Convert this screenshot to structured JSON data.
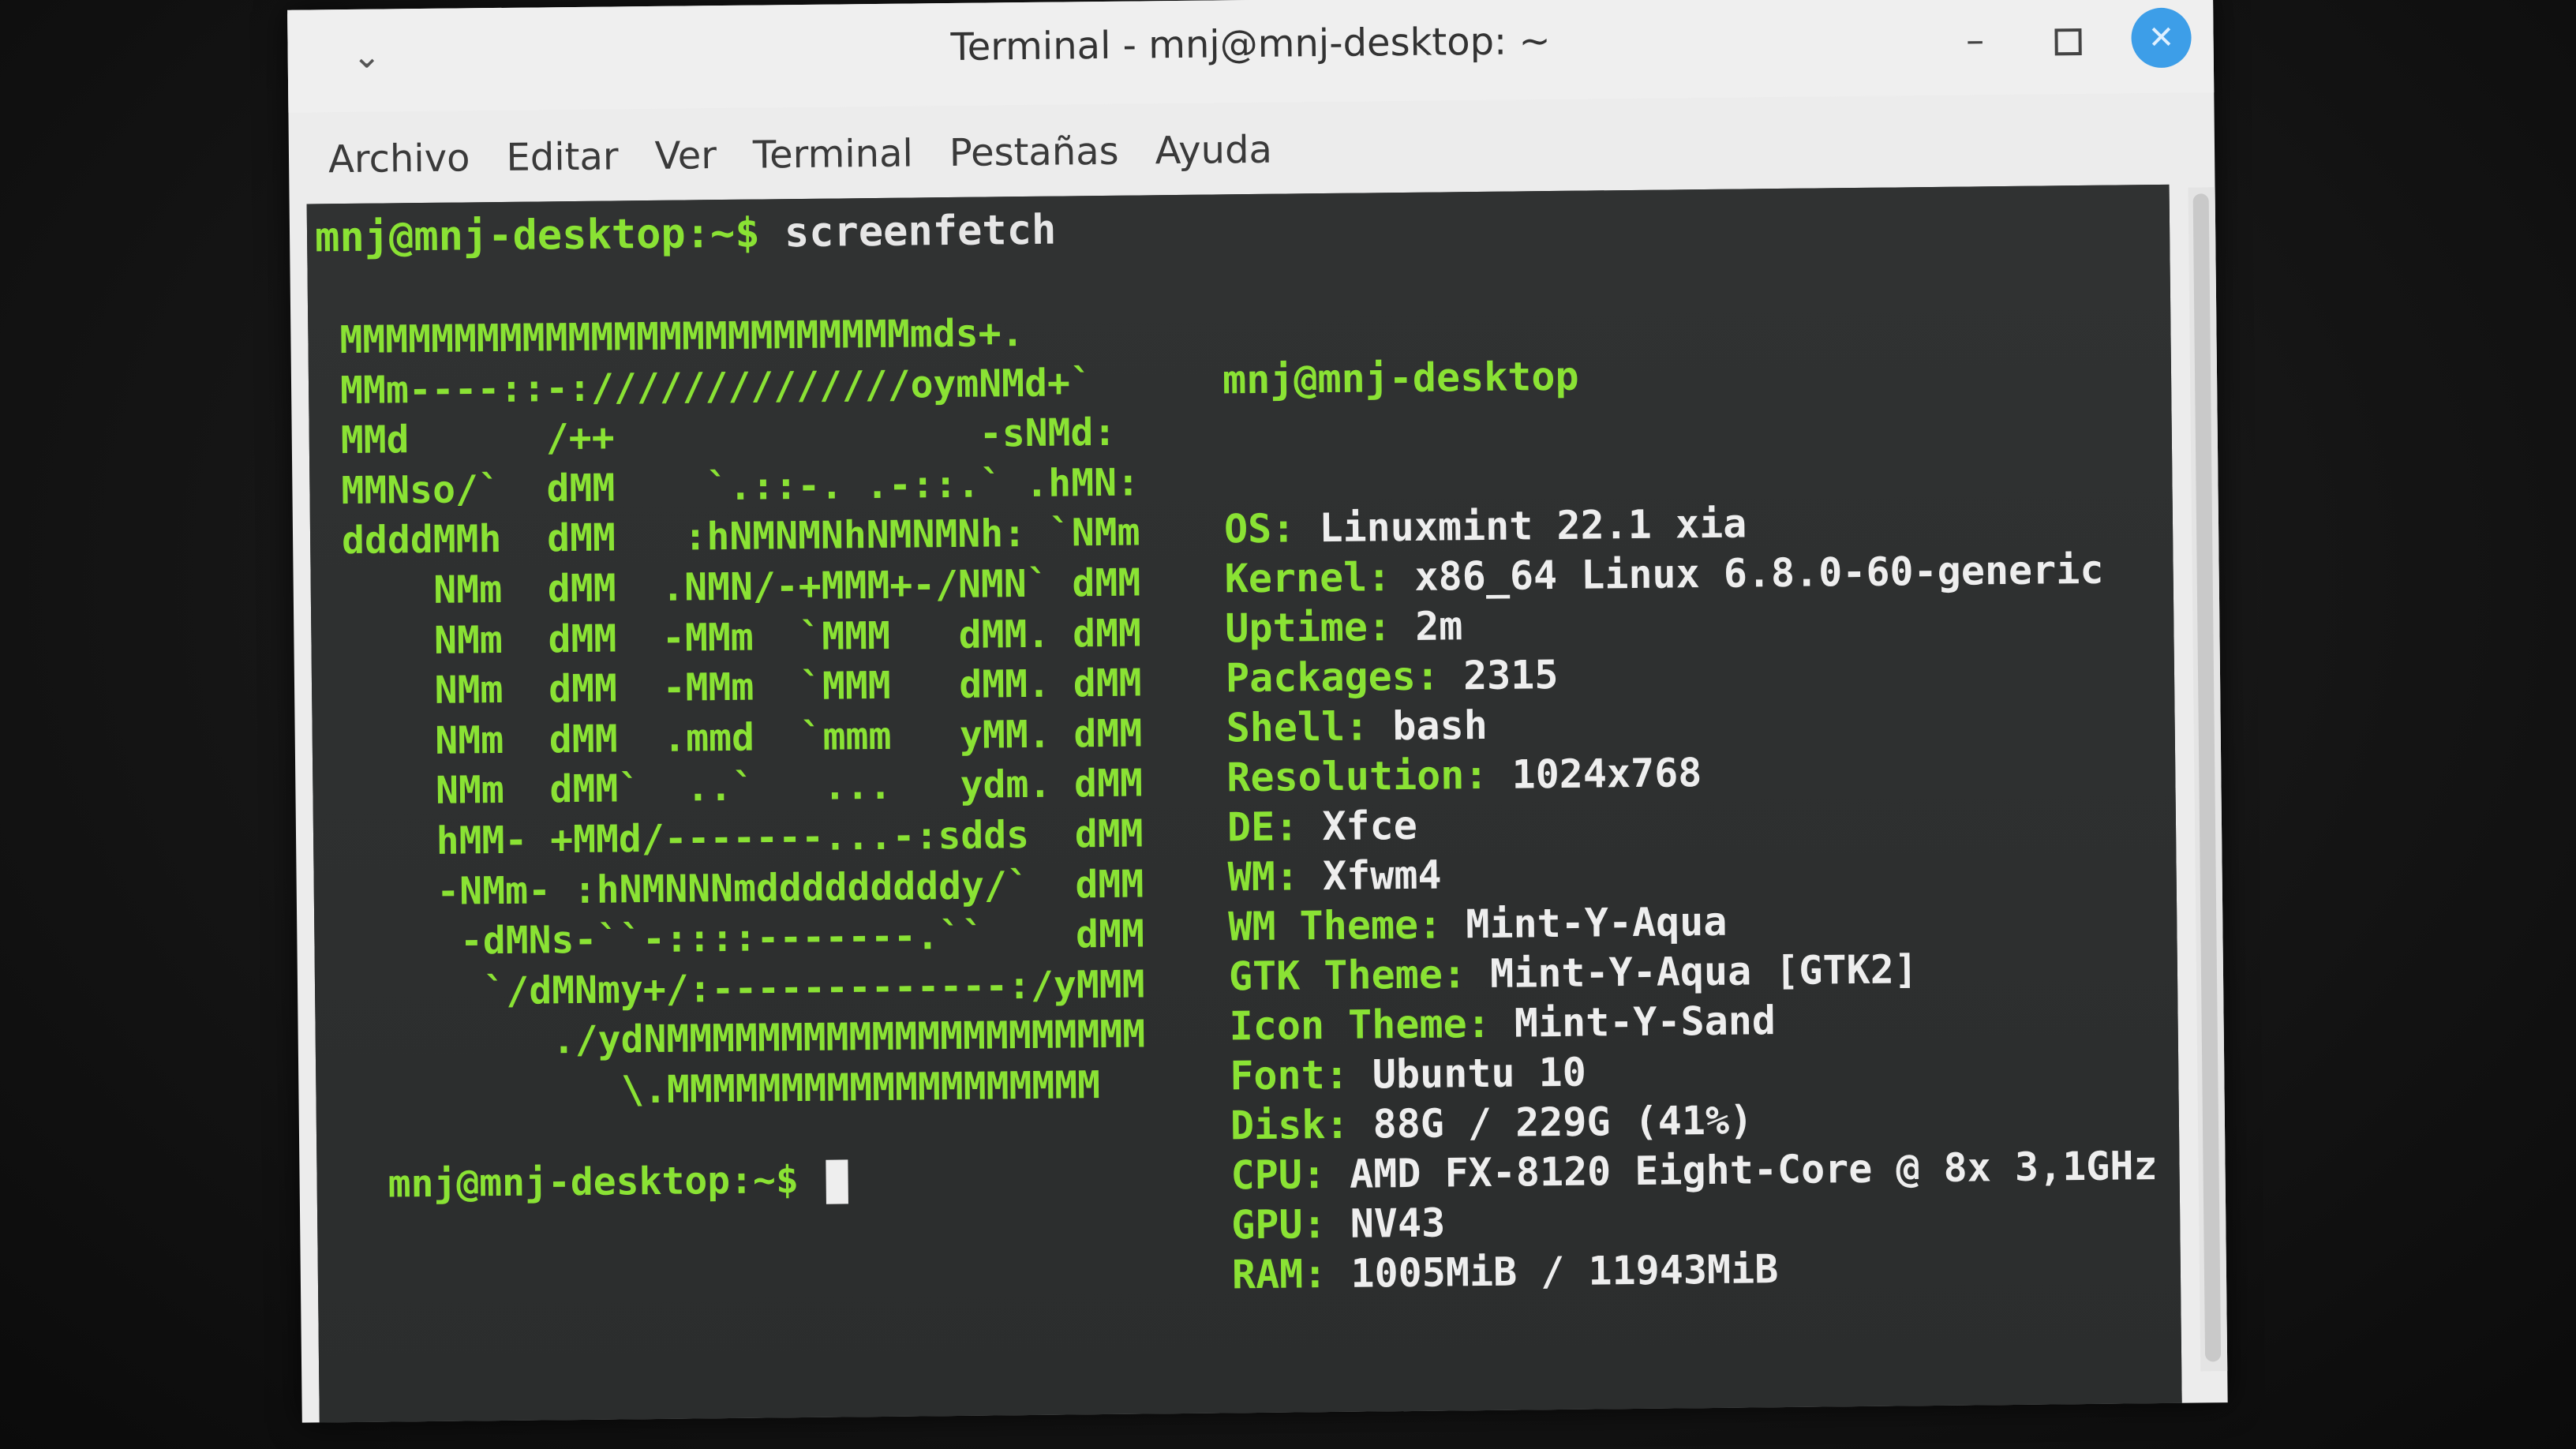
{
  "window": {
    "title": "Terminal - mnj@mnj-desktop: ~"
  },
  "menu": [
    "Archivo",
    "Editar",
    "Ver",
    "Terminal",
    "Pestañas",
    "Ayuda"
  ],
  "terminal": {
    "prompt": "mnj@mnj-desktop:~$",
    "command": " screenfetch",
    "hostname": "mnj@mnj-desktop",
    "art": [
      "MMMMMMMMMMMMMMMMMMMMMMMMMmds+.",
      "MMm----::-://////////////oymNMd+`",
      "MMd      /++                -sNMd:",
      "MMNso/`  dMM    `.::-. .-::.` .hMN:",
      "ddddMMh  dMM   :hNMNMNhNMNMNh: `NMm",
      "    NMm  dMM  .NMN/-+MMM+-/NMN` dMM",
      "    NMm  dMM  -MMm  `MMM   dMM. dMM",
      "    NMm  dMM  -MMm  `MMM   dMM. dMM",
      "    NMm  dMM  .mmd  `mmm   yMM. dMM",
      "    NMm  dMM`  ..`   ...   ydm. dMM",
      "    hMM- +MMd/-------...-:sdds  dMM",
      "    -NMm- :hNMNNNmdddddddddy/`  dMM",
      "     -dMNs-``-::::-------.``    dMM",
      "      `/dMNmy+/:-------------:/yMMM",
      "         ./ydNMMMMMMMMMMMMMMMMMMMMM",
      "            \\.MMMMMMMMMMMMMMMMMMM"
    ],
    "info": [
      {
        "label": "OS:",
        "value": " Linuxmint 22.1 xia"
      },
      {
        "label": "Kernel:",
        "value": " x86_64 Linux 6.8.0-60-generic"
      },
      {
        "label": "Uptime:",
        "value": " 2m"
      },
      {
        "label": "Packages:",
        "value": " 2315"
      },
      {
        "label": "Shell:",
        "value": " bash"
      },
      {
        "label": "Resolution:",
        "value": " 1024x768"
      },
      {
        "label": "DE:",
        "value": " Xfce"
      },
      {
        "label": "WM:",
        "value": " Xfwm4"
      },
      {
        "label": "WM Theme:",
        "value": " Mint-Y-Aqua"
      },
      {
        "label": "GTK Theme:",
        "value": " Mint-Y-Aqua [GTK2]"
      },
      {
        "label": "Icon Theme:",
        "value": " Mint-Y-Sand"
      },
      {
        "label": "Font:",
        "value": " Ubuntu 10"
      },
      {
        "label": "Disk:",
        "value": " 88G / 229G (41%)"
      },
      {
        "label": "CPU:",
        "value": " AMD FX-8120 Eight-Core @ 8x 3,1GHz"
      },
      {
        "label": "GPU:",
        "value": " NV43"
      },
      {
        "label": "RAM:",
        "value": " 1005MiB / 11943MiB"
      }
    ],
    "prompt_end": "mnj@mnj-desktop:~$ "
  },
  "colors": {
    "prompt_green": "#8ae234",
    "terminal_bg": "#2e3030",
    "close_button": "#3d9ee8"
  }
}
